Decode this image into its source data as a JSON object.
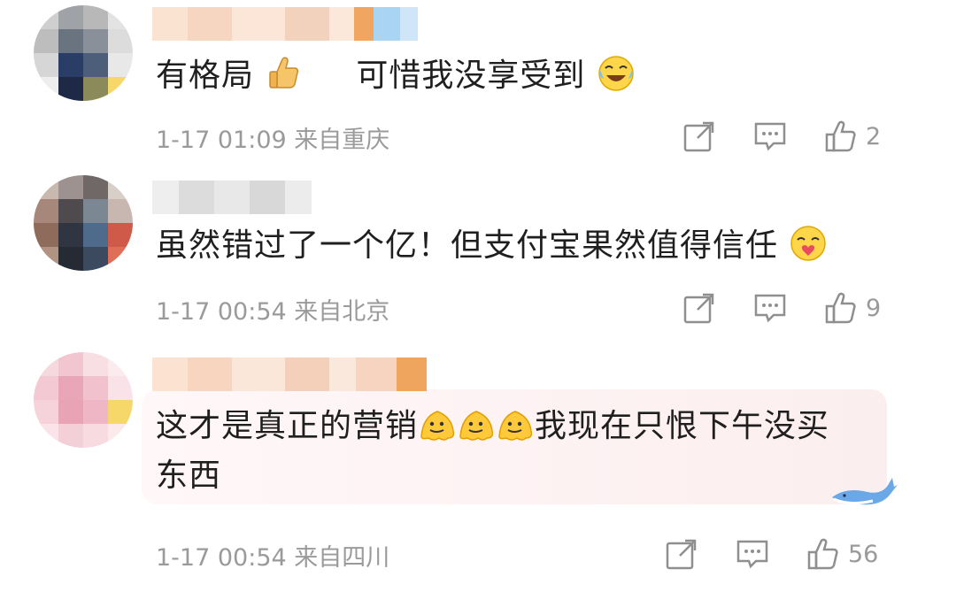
{
  "comments": [
    {
      "text": "有格局",
      "text2": "可惜我没享受到",
      "meta": "1-17 01:09 来自重庆",
      "likes": "2",
      "emojis": [
        "thumbs-up-icon",
        "laughing-crying-icon"
      ]
    },
    {
      "text": "虽然错过了一个亿！但支付宝果然值得信任",
      "meta": "1-17 00:54 来自北京",
      "likes": "9",
      "emojis": [
        "heart-kiss-icon"
      ]
    },
    {
      "text": "这才是真正的营销",
      "text2": "我现在只恨下午没买",
      "text3": "东西",
      "meta": "1-17 00:54 来自四川",
      "likes": "56",
      "emojis": [
        "melting-face-icon",
        "melting-face-icon",
        "melting-face-icon"
      ]
    }
  ],
  "colors": {
    "meta_gray": "#9a9a9a",
    "icon_gray": "#8f8f8f",
    "bubble_pink": "#fdf1f2"
  }
}
